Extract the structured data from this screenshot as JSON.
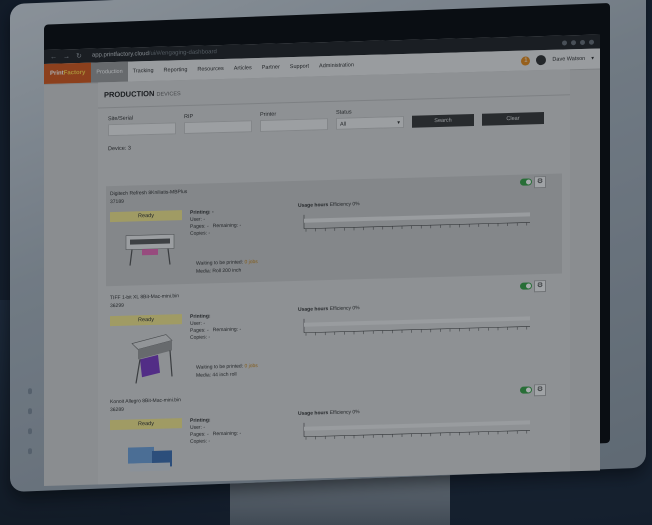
{
  "browser": {
    "url_host": "app.printfactory.cloud",
    "url_path": "/ui/#/engaging-dashboard"
  },
  "app": {
    "logo_prefix": "Print",
    "logo_suffix": "Factory",
    "menu": [
      "Production",
      "Tracking",
      "Reporting",
      "Resources",
      "Articles",
      "Partner",
      "Support",
      "Administration"
    ],
    "active_menu": "Production",
    "notifications_count": "1",
    "user_name": "Dave Watson"
  },
  "page": {
    "title": "PRODUCTION",
    "subtitle": "DEVICES"
  },
  "filters": {
    "site_label": "Site/Serial",
    "rip_label": "RIP",
    "printer_label": "Printer",
    "status_label": "Status",
    "status_value": "All",
    "search_button": "Search",
    "clear_button": "Clear"
  },
  "device_count_label": "Device: 3",
  "devices": [
    {
      "name": "Digitech Refresh 8Kniliatis-MBPlus",
      "serial": "37189",
      "status": "Ready",
      "printing_label": "Printing: -",
      "user": "User: -",
      "pages": "Pages: -",
      "remaining": "Remaining: -",
      "copies": "Copies: -",
      "waiting_label": "Waiting to be printed:",
      "waiting_value": "0 jobs",
      "media": "Media: Roll 200 inch",
      "usage_label": "Usage hours",
      "efficiency": "Efficiency 0%"
    },
    {
      "name": "TIFF 1-bit XL 8Bit-Mac-mini.bin",
      "serial": "36299",
      "status": "Ready",
      "printing_label": "Printing:",
      "user": "User: -",
      "pages": "Pages: -",
      "remaining": "Remaining: -",
      "copies": "Copies: -",
      "waiting_label": "Waiting to be printed:",
      "waiting_value": "0 jobs",
      "media": "Media: 44 inch roll",
      "usage_label": "Usage hours",
      "efficiency": "Efficiency 0%"
    },
    {
      "name": "Konoit Allegro 8Bit-Mac-mini.bin",
      "serial": "36289",
      "status": "Ready",
      "printing_label": "Printing:",
      "user": "User: -",
      "pages": "Pages: -",
      "remaining": "Remaining: -",
      "copies": "Copies: -",
      "waiting_label": "",
      "waiting_value": "",
      "media": "",
      "usage_label": "Usage hours",
      "efficiency": "Efficiency 0%"
    }
  ],
  "colors": {
    "logo_bg": "#d35a1f",
    "status_ready": "#f1e58c",
    "toggle_on": "#3aa048"
  }
}
